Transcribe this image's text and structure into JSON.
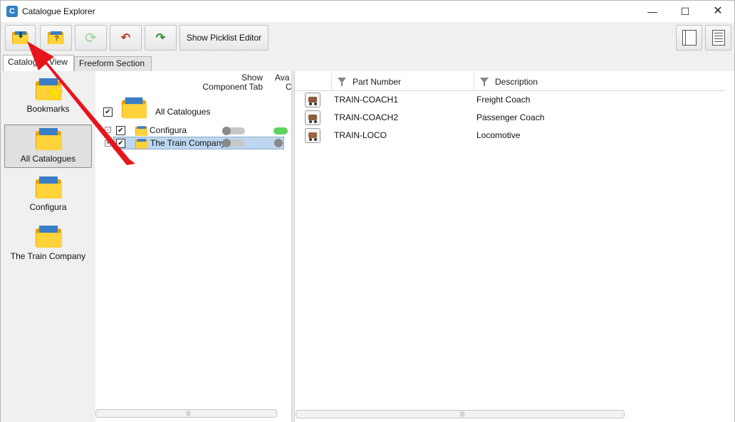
{
  "window": {
    "title": "Catalogue Explorer",
    "minimize_glyph": "—",
    "maximize_glyph": "☐",
    "close_glyph": "✕",
    "app_icon_letter": "C"
  },
  "toolbar": {
    "show_picklist_label": "Show Picklist Editor",
    "icons": [
      "import-catalogue-icon",
      "catalogue-info-icon",
      "refresh-icon",
      "undo-icon",
      "redo-icon",
      "panel-layout-icon",
      "list-view-icon"
    ],
    "undo_glyph": "↶",
    "redo_glyph": "↷",
    "refresh_glyph": "⟳"
  },
  "tabs": [
    {
      "label": "Catalogue View",
      "active": true
    },
    {
      "label": "Freeform Section",
      "active": false
    }
  ],
  "sidebar": {
    "items": [
      {
        "label": "Bookmarks",
        "selected": false
      },
      {
        "label": "All Catalogues",
        "selected": true
      },
      {
        "label": "Configura",
        "selected": false
      },
      {
        "label": "The Train Company",
        "selected": false
      }
    ]
  },
  "tree": {
    "header_show_line1": "Show",
    "header_show_line2": "Component Tab",
    "header_avail_line1": "Ava",
    "header_avail_line2": "C",
    "root": {
      "label": "All Catalogues",
      "checked": true
    },
    "nodes": [
      {
        "label": "Configura",
        "checked": true,
        "expander": "-",
        "show_tab": false,
        "available": true
      },
      {
        "label": "The Train Company",
        "checked": true,
        "expander": "+",
        "show_tab": false,
        "available": false
      }
    ],
    "scroll_grip": "|||"
  },
  "grid": {
    "columns": [
      "Part Number",
      "Description"
    ],
    "rows": [
      {
        "part": "TRAIN-COACH1",
        "description": "Freight Coach"
      },
      {
        "part": "TRAIN-COACH2",
        "description": "Passenger Coach"
      },
      {
        "part": "TRAIN-LOCO",
        "description": "Locomotive"
      }
    ],
    "scroll_grip": "|||"
  },
  "annotation": {
    "arrow_color": "#e8141c"
  }
}
